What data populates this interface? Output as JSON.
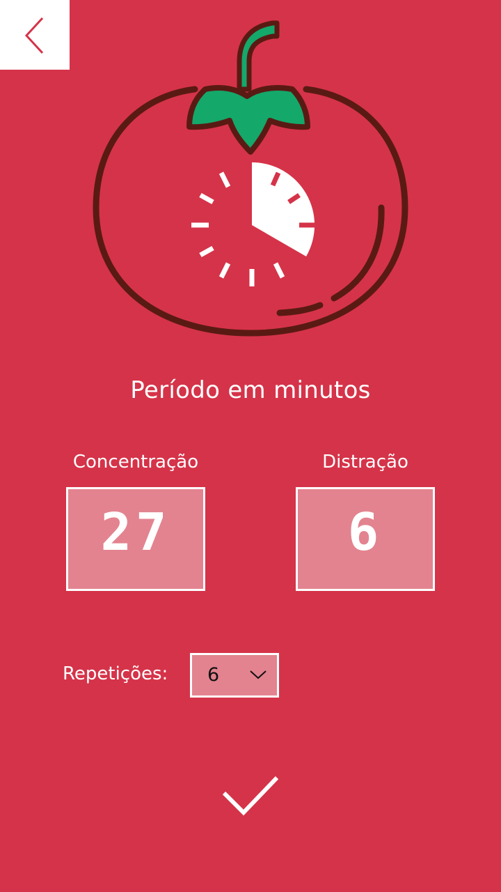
{
  "header": {
    "back_icon": "chevron-left-icon"
  },
  "illustration": {
    "icon": "tomato-timer-icon",
    "colors": {
      "outline": "#5a1a14",
      "leaf": "#14a86a",
      "dial": "#ffffff"
    }
  },
  "period": {
    "title": "Período em minutos",
    "focus": {
      "label": "Concentração",
      "value": "27"
    },
    "break": {
      "label": "Distração",
      "value": "6"
    }
  },
  "repetitions": {
    "label": "Repetições:",
    "selected": "6",
    "icon": "chevron-down-icon"
  },
  "confirm": {
    "icon": "checkmark-icon"
  },
  "colors": {
    "background": "#d53349",
    "field": "#e3838f",
    "border": "#ffffff"
  }
}
